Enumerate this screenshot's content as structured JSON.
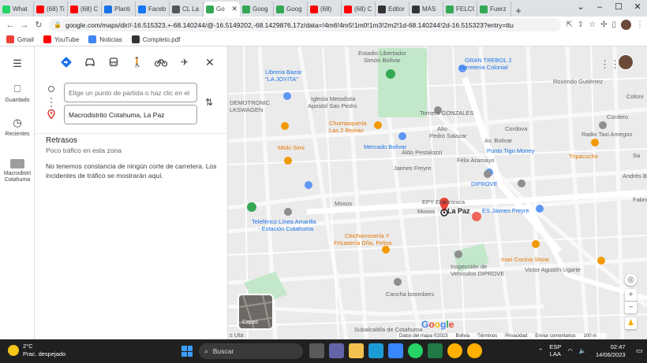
{
  "browser": {
    "tabs": [
      {
        "label": "What",
        "color": "#25d366",
        "active": false
      },
      {
        "label": "(68) Ti",
        "color": "#ff0000",
        "active": false
      },
      {
        "label": "(68) C",
        "color": "#ff0000",
        "active": false
      },
      {
        "label": "Planti",
        "color": "#1a73e8",
        "active": false
      },
      {
        "label": "Faceb",
        "color": "#1877f2",
        "active": false
      },
      {
        "label": "CL La",
        "color": "#555555",
        "active": false
      },
      {
        "label": "Go",
        "color": "#34a853",
        "active": true
      },
      {
        "label": "Goog",
        "color": "#34a853",
        "active": false
      },
      {
        "label": "Goog",
        "color": "#34a853",
        "active": false
      },
      {
        "label": "(68)",
        "color": "#ff0000",
        "active": false
      },
      {
        "label": "(68) C",
        "color": "#ff0000",
        "active": false
      },
      {
        "label": "Editor",
        "color": "#333333",
        "active": false
      },
      {
        "label": "MÁS",
        "color": "#333333",
        "active": false
      },
      {
        "label": "FELCC",
        "color": "#34a853",
        "active": false
      },
      {
        "label": "Fuerz",
        "color": "#34a853",
        "active": false
      }
    ],
    "url": "google.com/maps/dir//-16.515323,+-68.140244/@-16.5149202,-68.1429876,17z/data=!4m6!4m5!1m0!1m3!2m2!1d-68.140244!2d-16.515323?entry=ttu",
    "bookmarks": [
      {
        "label": "Gmail",
        "color": "#ea4335"
      },
      {
        "label": "YouTube",
        "color": "#ff0000"
      },
      {
        "label": "Noticias",
        "color": "#4285f4"
      },
      {
        "label": "Completo.pdf",
        "color": "#333333"
      }
    ]
  },
  "rail": {
    "saved_label": "Guardado",
    "recent_label": "Recientes",
    "place_label": "Macrodistri Cotahuma"
  },
  "directions": {
    "origin_placeholder": "Elige un punto de partida o haz clic en el",
    "destination_value": "Macrodistrito Cotahuma, La Paz",
    "delays_title": "Retrasos",
    "delays_subtitle": "Poco tráfico en esta zona",
    "delays_body": "No tenemos constancia de ningún corte de carretera. Los incidentes de tráfico se mostrarán aquí."
  },
  "map": {
    "labels": [
      {
        "text": "Libreria Bazar",
        "color": "#1a73e8"
      },
      {
        "text": "\"LA JOYITA\"",
        "color": "#1a73e8"
      },
      {
        "text": "Estadio Libertador",
        "color": "#5f6368"
      },
      {
        "text": "Simón Bolívar",
        "color": "#5f6368"
      },
      {
        "text": "Iglesia Metodista",
        "color": "#5f6368"
      },
      {
        "text": "Apostol San Pedro",
        "color": "#5f6368"
      },
      {
        "text": "DEMOTRONIC",
        "color": "#5f6368"
      },
      {
        "text": "LKSWAGEN",
        "color": "#5f6368"
      },
      {
        "text": "Churrasqueria",
        "color": "#e37400"
      },
      {
        "text": "Las 2 Reinas",
        "color": "#e37400"
      },
      {
        "text": "Mercado Bolivar",
        "color": "#1a73e8"
      },
      {
        "text": "Tornero GONZALES",
        "color": "#5f6368"
      },
      {
        "text": "Miski Simi",
        "color": "#e37400"
      },
      {
        "text": "Punto Tigo Money",
        "color": "#1a73e8"
      },
      {
        "text": "Radio Taxi Amegos",
        "color": "#5f6368"
      },
      {
        "text": "Tripacucho",
        "color": "#e37400"
      },
      {
        "text": "DIPROVE",
        "color": "#1a73e8"
      },
      {
        "text": "EPY Electrónica",
        "color": "#5f6368"
      },
      {
        "text": "La Paz",
        "color": "#202124"
      },
      {
        "text": "ES Jaimes Freyre",
        "color": "#1a73e8"
      },
      {
        "text": "Teleférico Línea Amarilla",
        "color": "#1a73e8"
      },
      {
        "text": "- Estación Cotahuma",
        "color": "#1a73e8"
      },
      {
        "text": "Chicharronería Y",
        "color": "#e37400"
      },
      {
        "text": "Fricasería Dña. Felisa",
        "color": "#e37400"
      },
      {
        "text": "Inari Cocina Show",
        "color": "#e37400"
      },
      {
        "text": "Inspección de",
        "color": "#5f6368"
      },
      {
        "text": "Vehículos DIPROVE",
        "color": "#5f6368"
      },
      {
        "text": "Cancha boombers",
        "color": "#5f6368"
      },
      {
        "text": "Subalcaldía de Cotahuma",
        "color": "#5f6368"
      },
      {
        "text": "Moxos",
        "color": "#5f6368"
      },
      {
        "text": "Jaimes Freyre",
        "color": "#5f6368"
      },
      {
        "text": "Victor Agustín Ugarte",
        "color": "#5f6368"
      },
      {
        "text": "Pedro Salazar",
        "color": "#5f6368"
      },
      {
        "text": "Av. Bolivar",
        "color": "#5f6368"
      },
      {
        "text": "Félix Aramayo",
        "color": "#5f6368"
      },
      {
        "text": "Aldo Pestalozzi",
        "color": "#5f6368"
      },
      {
        "text": "Rosendo Gutiérrez",
        "color": "#5f6368"
      },
      {
        "text": "Coloni",
        "color": "#5f6368"
      },
      {
        "text": "GRAN TREBOL 2",
        "color": "#1a73e8"
      },
      {
        "text": "Ferreteria Colonial",
        "color": "#1a73e8"
      },
      {
        "text": "Cordova",
        "color": "#5f6368"
      },
      {
        "text": "Andrés Bello",
        "color": "#5f6368"
      },
      {
        "text": "Sa",
        "color": "#5f6368"
      },
      {
        "text": "Fabrica",
        "color": "#5f6368"
      },
      {
        "text": "s Uta",
        "color": "#5f6368"
      },
      {
        "text": "Moxos",
        "color": "#5f6368"
      },
      {
        "text": "Alto",
        "color": "#5f6368"
      },
      {
        "text": "Cordero",
        "color": "#5f6368"
      }
    ],
    "layers_label": "Capas",
    "google_logo": "Google",
    "attribution": [
      "Datos del mapa ©2023",
      "Bolivia",
      "Términos",
      "Privacidad",
      "Enviar comentarios",
      "100 m"
    ]
  },
  "taskbar": {
    "temperature": "2°C",
    "weather": "Prac. despejado",
    "search_label": "Buscar",
    "language": "ESP",
    "region": "LAA",
    "time": "02:47",
    "date": "14/06/2023"
  }
}
